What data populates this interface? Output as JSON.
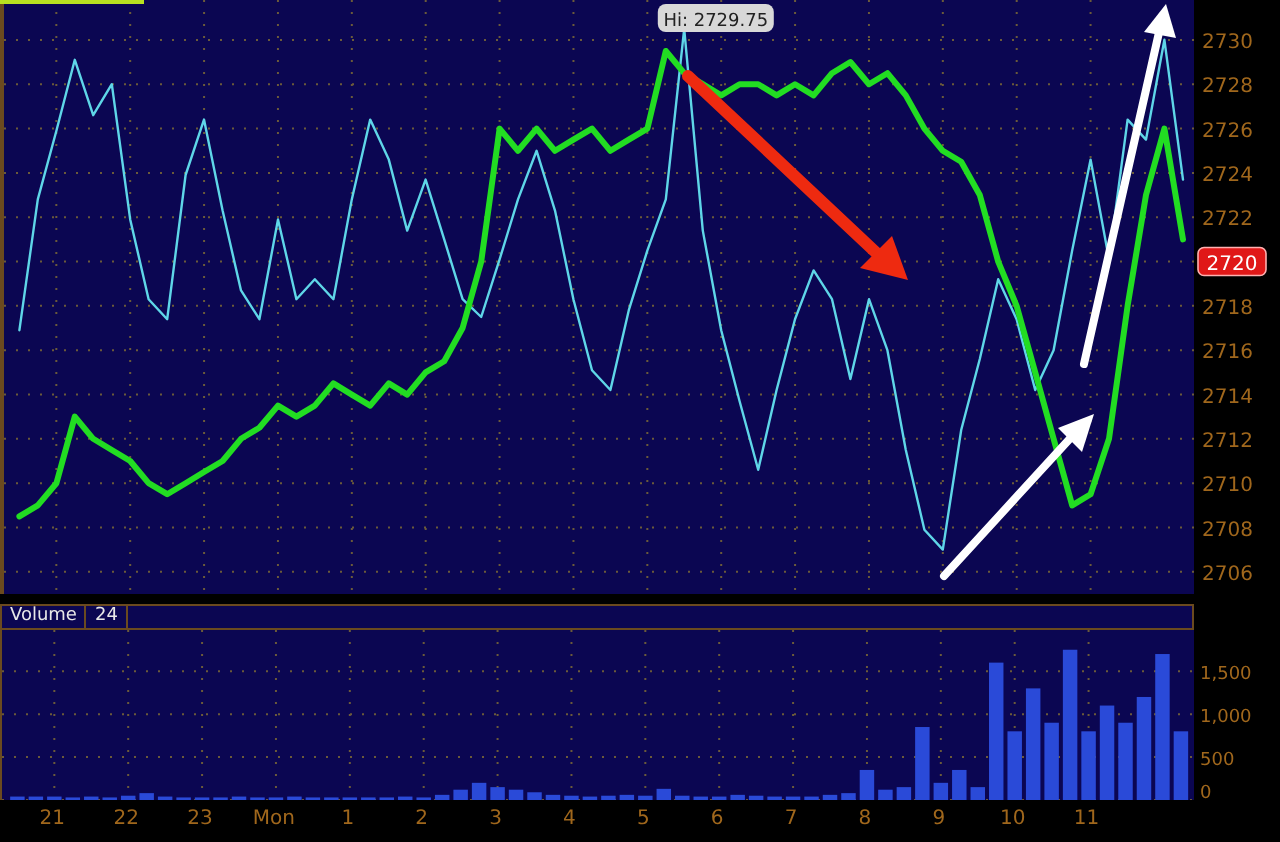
{
  "price_chart": {
    "chart_data": {
      "type": "line",
      "grid": true,
      "categories": [
        null,
        null,
        null,
        null,
        null,
        null,
        null,
        null,
        null,
        null,
        null,
        null,
        null,
        null,
        null,
        null,
        null,
        null,
        null,
        null,
        null,
        null,
        null,
        null,
        null,
        null,
        null,
        null,
        null,
        null,
        null,
        null,
        null,
        null,
        null,
        null,
        null,
        null,
        null,
        null,
        null,
        null,
        null,
        null,
        null,
        null,
        null,
        null,
        null,
        null,
        null,
        null,
        null,
        null,
        null,
        null,
        null,
        null,
        null,
        null,
        null,
        null,
        null,
        null
      ],
      "series": [
        {
          "color": "#5fd6e8",
          "values": [
            2716.9,
            2722.8,
            2725.9,
            2729.1,
            2726.6,
            2728,
            2721.9,
            2718.3,
            2717.4,
            2723.9,
            2726.4,
            2722.3,
            2718.7,
            2717.4,
            2721.9,
            2718.3,
            2719.2,
            2718.3,
            2722.8,
            2726.4,
            2724.6,
            2721.4,
            2723.7,
            2721,
            2718.3,
            2717.5,
            2720.1,
            2722.8,
            2725,
            2722.3,
            2718.3,
            2715.1,
            2714.2,
            2717.8,
            2720.5,
            2722.8,
            2730.5,
            2721.4,
            2716.9,
            2713.7,
            2710.6,
            2714.2,
            2717.4,
            2719.6,
            2718.3,
            2714.7,
            2718.3,
            2716,
            2711.5,
            2707.9,
            2707,
            2712.4,
            2715.6,
            2719.2,
            2717.4,
            2714.2,
            2716,
            2720.5,
            2724.6,
            2720.1,
            2726.4,
            2725.5,
            2730,
            2723.7
          ]
        },
        {
          "color": "#22dd22",
          "values": [
            2708.5,
            2709,
            2710,
            2713,
            2712,
            2711.5,
            2711,
            2710,
            2709.5,
            2710,
            2710.5,
            2711,
            2712,
            2712.5,
            2713.5,
            2713,
            2713.5,
            2714.5,
            2714,
            2713.5,
            2714.5,
            2714,
            2715,
            2715.5,
            2717,
            2720,
            2726,
            2725,
            2726,
            2725,
            2725.5,
            2726,
            2725,
            2725.5,
            2726,
            2729.5,
            2728.5,
            2728,
            2727.5,
            2728,
            2728,
            2727.5,
            2728,
            2727.5,
            2728.5,
            2729,
            2728,
            2728.5,
            2727.5,
            2726,
            2725,
            2724.5,
            2723,
            2720,
            2718,
            2715,
            2712,
            2709,
            2709.5,
            2712,
            2718,
            2723,
            2726,
            2721
          ]
        }
      ],
      "ylim": [
        2705,
        2731.8
      ],
      "yticks": [
        2706,
        2708,
        2710,
        2712,
        2714,
        2716,
        2718,
        2720,
        2722,
        2724,
        2726,
        2728,
        2730
      ],
      "annotations": [
        {
          "text": "Hi: 2729.75"
        }
      ]
    },
    "last_price_tag": "2720"
  },
  "volume_panel": {
    "label": "Volume",
    "value": "24",
    "chart_data": {
      "type": "bar",
      "grid": true,
      "categories": [
        null,
        null,
        "21",
        null,
        null,
        null,
        "22",
        null,
        null,
        null,
        "23",
        null,
        null,
        null,
        "Mon",
        null,
        null,
        null,
        "1",
        null,
        null,
        null,
        "2",
        null,
        null,
        null,
        "3",
        null,
        null,
        null,
        "4",
        null,
        null,
        null,
        "5",
        null,
        null,
        null,
        "6",
        null,
        null,
        null,
        "7",
        null,
        null,
        null,
        "8",
        null,
        null,
        null,
        "9",
        null,
        null,
        null,
        "10",
        null,
        null,
        null,
        "11",
        null,
        null,
        null,
        null,
        null
      ],
      "series": [
        {
          "color": "#2a4ad8",
          "values": [
            40,
            40,
            40,
            30,
            40,
            30,
            50,
            80,
            40,
            30,
            30,
            30,
            40,
            30,
            30,
            40,
            30,
            30,
            30,
            30,
            30,
            40,
            30,
            60,
            120,
            200,
            150,
            120,
            90,
            60,
            50,
            40,
            50,
            60,
            50,
            130,
            50,
            40,
            40,
            60,
            50,
            40,
            40,
            40,
            60,
            80,
            350,
            120,
            150,
            850,
            200,
            350,
            150,
            1600,
            800,
            1300,
            900,
            1750,
            800,
            1100,
            900,
            1200,
            1700,
            800
          ]
        }
      ],
      "ylim": [
        0,
        1980
      ],
      "yticks": [
        {
          "value": 0,
          "label": "0"
        },
        {
          "value": 500,
          "label": "500"
        },
        {
          "value": 1000,
          "label": "1,000"
        },
        {
          "value": 1500,
          "label": "1,500"
        }
      ]
    }
  }
}
